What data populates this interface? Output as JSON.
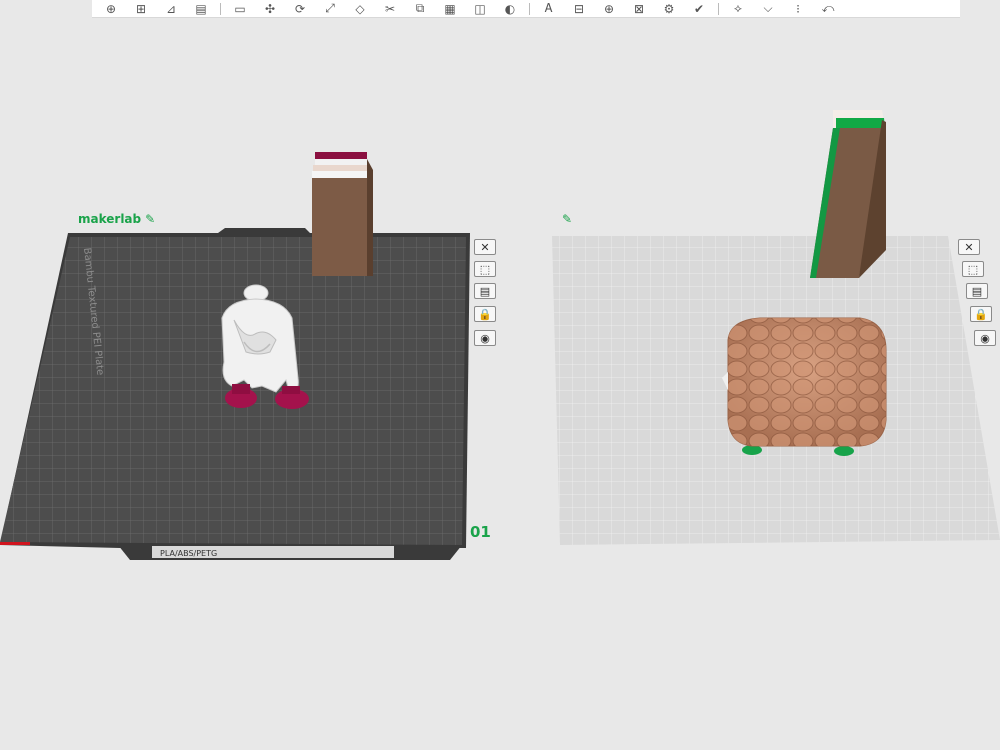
{
  "toolbar": {
    "icons": [
      "add-object-icon",
      "add-plate-icon",
      "auto-orient-icon",
      "arrange-icon",
      "split-icon",
      "move-icon",
      "rotate-icon",
      "scale-icon",
      "lay-flat-icon",
      "cut-icon",
      "mesh-boolean-icon",
      "support-paint-icon",
      "seam-paint-icon",
      "color-paint-icon",
      "text-icon",
      "assembly-icon",
      "measure-icon",
      "variable-layer-icon",
      "settings-icon",
      "slice-icon",
      "send-icon",
      "more-icon",
      "help-icon",
      "expand-icon"
    ],
    "glyphs": [
      "⊕",
      "⊞",
      "⊿",
      "▤",
      "▭",
      "✣",
      "⟳",
      "⤢",
      "◇",
      "✂",
      "⧉",
      "▦",
      "◫",
      "◐",
      "Ꭺ",
      "⊟",
      "⊕",
      "⊠",
      "⚙",
      "✔",
      "⟡",
      "⌵",
      "⁝",
      "⤺"
    ]
  },
  "plates": [
    {
      "name": "makerlab",
      "number": "01",
      "edit_icon": "pencil-icon",
      "bed_style": "dark",
      "bed_text": "Bambu Textured PEI Plate",
      "footer_text": "PLA/ABS/PETG",
      "objects": [
        "doctor-figurine",
        "prime-tower-white-red"
      ],
      "tools": [
        {
          "name": "remove-plate-icon",
          "glyph": "✕"
        },
        {
          "name": "pick-object-icon",
          "glyph": "⬚"
        },
        {
          "name": "arrange-plate-icon",
          "glyph": "▤"
        },
        {
          "name": "lock-plate-icon",
          "glyph": "🔒"
        },
        {
          "name": "plate-settings-icon",
          "glyph": "◉"
        }
      ]
    },
    {
      "name": "",
      "number": "",
      "edit_icon": "pencil-icon",
      "bed_style": "light",
      "objects": [
        "rock-textured-cube",
        "prime-tower-green"
      ],
      "tools": [
        {
          "name": "remove-plate-icon",
          "glyph": "✕"
        },
        {
          "name": "pick-object-icon",
          "glyph": "⬚"
        },
        {
          "name": "arrange-plate-icon",
          "glyph": "▤"
        },
        {
          "name": "lock-plate-icon",
          "glyph": "🔒"
        },
        {
          "name": "plate-settings-icon",
          "glyph": "◉"
        }
      ]
    }
  ],
  "colors": {
    "accent": "#1aa34a",
    "dark_bed": "#4a4a4a",
    "light_bed": "#dcdcdc",
    "tower_brown": "#7a5a45",
    "figure_white": "#f0f0f0",
    "figure_magenta": "#a0104a",
    "rock": "#c8906e"
  }
}
